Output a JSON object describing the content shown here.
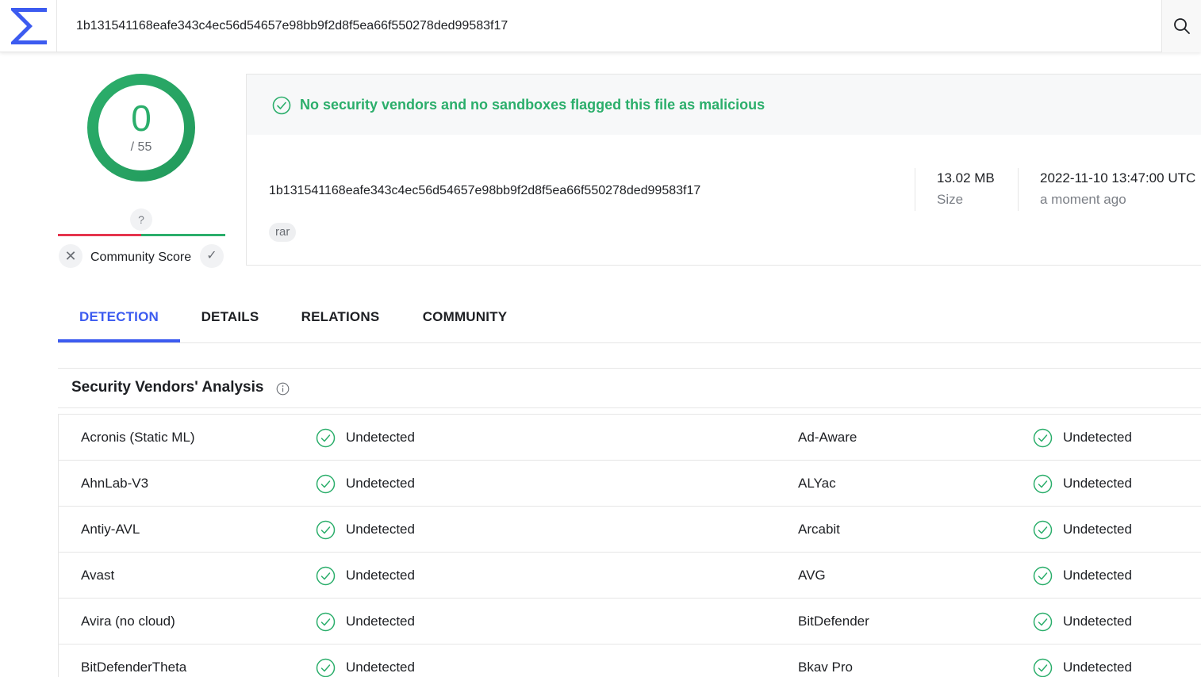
{
  "search": {
    "value": "1b131541168eafe343c4ec56d54657e98bb9f2d8f5ea66f550278ded99583f17"
  },
  "score": {
    "detections": "0",
    "total": "/ 55"
  },
  "community": {
    "unknown_marker": "?",
    "label": "Community Score",
    "vote_down": "✕",
    "vote_up": "✓"
  },
  "summary": {
    "banner": "No security vendors and no sandboxes flagged this file as malicious",
    "hash": "1b131541168eafe343c4ec56d54657e98bb9f2d8f5ea66f550278ded99583f17",
    "tag": "rar",
    "size_value": "13.02 MB",
    "size_label": "Size",
    "date_value": "2022-11-10 13:47:00 UTC",
    "date_relative": "a moment ago"
  },
  "tabs": [
    {
      "label": "DETECTION",
      "active": true
    },
    {
      "label": "DETAILS",
      "active": false
    },
    {
      "label": "RELATIONS",
      "active": false
    },
    {
      "label": "COMMUNITY",
      "active": false
    }
  ],
  "vendors_panel": {
    "title": "Security Vendors' Analysis"
  },
  "vendors": [
    {
      "left": "Acronis (Static ML)",
      "left_result": "Undetected",
      "right": "Ad-Aware",
      "right_result": "Undetected"
    },
    {
      "left": "AhnLab-V3",
      "left_result": "Undetected",
      "right": "ALYac",
      "right_result": "Undetected"
    },
    {
      "left": "Antiy-AVL",
      "left_result": "Undetected",
      "right": "Arcabit",
      "right_result": "Undetected"
    },
    {
      "left": "Avast",
      "left_result": "Undetected",
      "right": "AVG",
      "right_result": "Undetected"
    },
    {
      "left": "Avira (no cloud)",
      "left_result": "Undetected",
      "right": "BitDefender",
      "right_result": "Undetected"
    },
    {
      "left": "BitDefenderTheta",
      "left_result": "Undetected",
      "right": "Bkav Pro",
      "right_result": "Undetected"
    }
  ],
  "colors": {
    "brand": "#3c5bf0",
    "clean": "#2bae6b",
    "malicious": "#e5344d"
  },
  "icons": {
    "logo": "sigma-logo-icon",
    "search": "search-icon",
    "clean": "check-circle-icon",
    "info": "info-icon"
  }
}
